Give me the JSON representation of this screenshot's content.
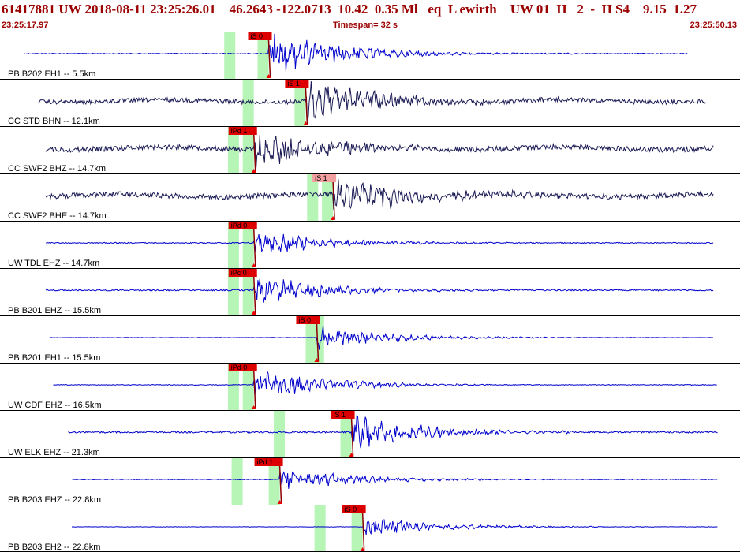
{
  "header": {
    "event_line": "61417881 UW 2018-08-11 23:25:26.01    46.2643 -122.0713  10.42  0.35 Ml   eq  L ewirth    UW 01  H   2  -  H S4    9.15  1.27",
    "start_time": "23:25:17.97",
    "timespan_label": "Timespan=  32 s",
    "end_time": "23:25:50.13"
  },
  "colors": {
    "title": "#9b0000",
    "trace_primary": "#0000cc",
    "trace_secondary": "#1a1a55",
    "pick_label_bg": "#dd0000",
    "pick_label_bg_light": "#f5a0a0",
    "window_band": "#b6f5b6",
    "pick_marker": "#ee0000",
    "frame": "#000000"
  },
  "traces": [
    {
      "label": "PB B202 EH1 -- 5.5km",
      "color": "trace_primary",
      "picks": [
        {
          "text": "iS 0",
          "onset": 0.363
        }
      ],
      "onset": 0.363,
      "noise": 0.05,
      "amp": 0.85
    },
    {
      "label": "CC STD BHN -- 12.1km",
      "color": "trace_secondary",
      "picks": [
        {
          "text": "iS 1",
          "onset": 0.413
        }
      ],
      "onset": 0.413,
      "noise": 0.25,
      "amp": 0.8
    },
    {
      "label": "CC SWF2 BHZ -- 14.7km",
      "color": "trace_secondary",
      "picks": [
        {
          "text": "iPd 1",
          "onset": 0.343
        }
      ],
      "onset": 0.343,
      "noise": 0.3,
      "amp": 0.7
    },
    {
      "label": "CC SWF2 BHE -- 14.7km",
      "color": "trace_secondary",
      "picks": [
        {
          "text": "iS 1",
          "onset": 0.45
        }
      ],
      "onset": 0.45,
      "noise": 0.3,
      "amp": 0.8
    },
    {
      "label": "UW TDL EHZ -- 14.7km",
      "color": "trace_primary",
      "picks": [
        {
          "text": "iPd 0",
          "onset": 0.343
        }
      ],
      "onset": 0.343,
      "noise": 0.06,
      "amp": 0.5
    },
    {
      "label": "PB B201 EHZ -- 15.5km",
      "color": "trace_primary",
      "picks": [
        {
          "text": "iPc 0",
          "onset": 0.343
        }
      ],
      "onset": 0.343,
      "noise": 0.08,
      "amp": 0.55
    },
    {
      "label": "PB B201 EH1 -- 15.5km",
      "color": "trace_primary",
      "picks": [
        {
          "text": "iS 0",
          "onset": 0.428
        }
      ],
      "onset": 0.428,
      "noise": 0.02,
      "amp": 0.45
    },
    {
      "label": "UW CDF EHZ -- 16.5km",
      "color": "trace_primary",
      "picks": [
        {
          "text": "iPd 0",
          "onset": 0.343
        }
      ],
      "onset": 0.343,
      "noise": 0.04,
      "amp": 0.6
    },
    {
      "label": "UW ELK EHZ -- 21.3km",
      "color": "trace_primary",
      "picks": [
        {
          "text": "iS 1",
          "onset": 0.475
        }
      ],
      "onset": 0.475,
      "noise": 0.1,
      "amp": 0.7
    },
    {
      "label": "PB B203 EHZ -- 22.8km",
      "color": "trace_primary",
      "picks": [
        {
          "text": "iPd 1",
          "onset": 0.378
        }
      ],
      "onset": 0.378,
      "noise": 0.04,
      "amp": 0.45
    },
    {
      "label": "PB B203 EH2 -- 22.8km",
      "color": "trace_primary",
      "picks": [
        {
          "text": "iS 0",
          "onset": 0.49
        }
      ],
      "onset": 0.49,
      "noise": 0.02,
      "amp": 0.4
    }
  ]
}
